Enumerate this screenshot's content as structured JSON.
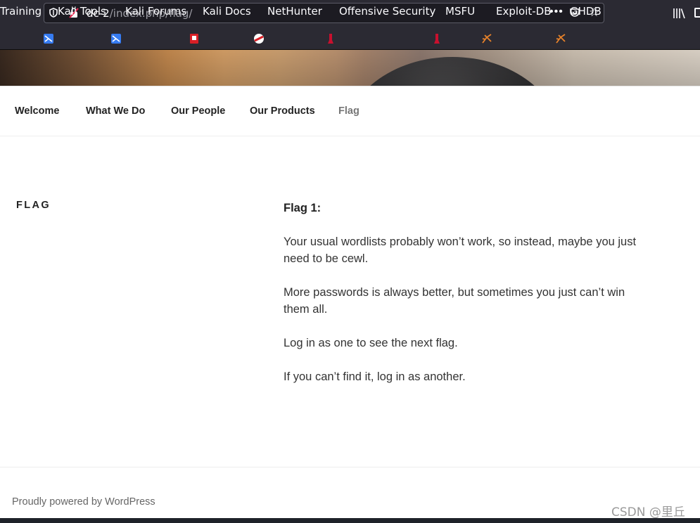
{
  "browser": {
    "url_host": "dc-2",
    "url_path": "/index.php/flag/",
    "page_actions": "•••",
    "bookmark_star": "☆",
    "bookmarks": [
      {
        "label": "Training",
        "icon": "kali-training-icon"
      },
      {
        "label": "Kali Tools",
        "icon": "kali-tools-icon"
      },
      {
        "label": "Kali Forums",
        "icon": "kali-forums-icon"
      },
      {
        "label": "Kali Docs",
        "icon": "kali-docs-icon"
      },
      {
        "label": "NetHunter",
        "icon": "nethunter-icon"
      },
      {
        "label": "Offensive Security",
        "icon": "offsec-icon"
      },
      {
        "label": "MSFU",
        "icon": "msfu-icon"
      },
      {
        "label": "Exploit-DB",
        "icon": "exploit-db-icon"
      },
      {
        "label": "GHDB",
        "icon": "ghdb-icon"
      }
    ]
  },
  "nav": {
    "items": [
      {
        "label": "Welcome"
      },
      {
        "label": "What We Do"
      },
      {
        "label": "Our People"
      },
      {
        "label": "Our Products"
      },
      {
        "label": "Flag"
      }
    ]
  },
  "page": {
    "title": "FLAG",
    "paragraphs": [
      "Flag 1:",
      "Your usual wordlists probably won’t work, so instead, maybe you just need to be cewl.",
      "More passwords is always better, but sometimes you just can’t win them all.",
      "Log in as one to see the next flag.",
      "If you can’t find it, log in as another."
    ]
  },
  "footer": {
    "credit": "Proudly powered by WordPress"
  },
  "watermark": "CSDN @里丘",
  "colors": {
    "chrome": "#2b2a33",
    "urlbar": "#1c1b22",
    "nav_current": "#767676",
    "text": "#333333"
  }
}
